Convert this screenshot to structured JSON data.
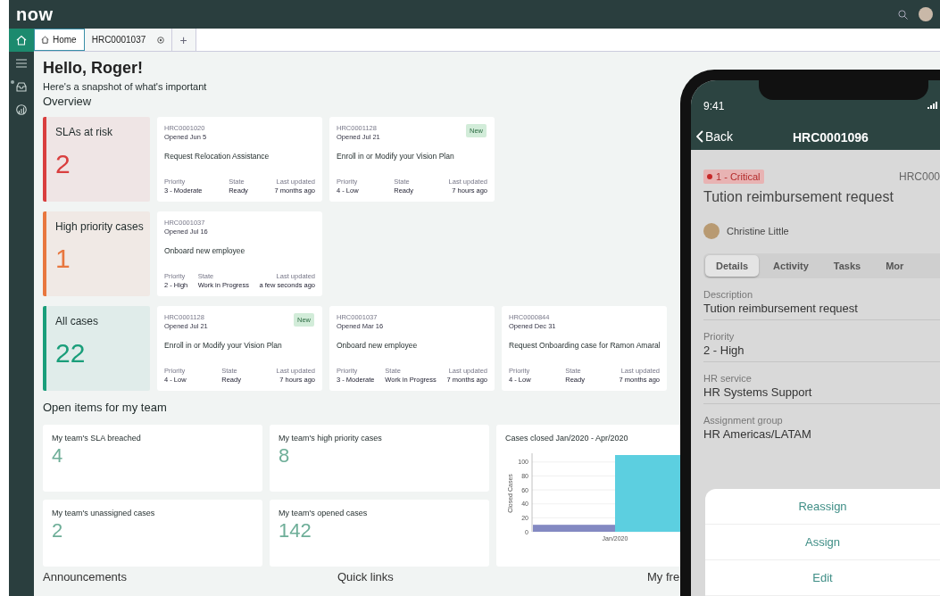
{
  "header": {
    "logo": "now"
  },
  "nav_items": [
    {
      "kind": "home",
      "selected": true,
      "notification": false
    },
    {
      "kind": "list",
      "selected": false,
      "notification": false
    },
    {
      "kind": "inbox",
      "selected": false,
      "notification": true
    },
    {
      "kind": "analytics",
      "selected": false,
      "notification": false
    }
  ],
  "tabs": [
    {
      "label": "Home",
      "kind": "home",
      "selected": true
    },
    {
      "label": "HRC0001037",
      "kind": "record",
      "selected": false
    }
  ],
  "new_tab": "+",
  "greeting": "Hello, Roger!",
  "subtitle": "Here's a snapshot of what's important",
  "overview_heading": "Overview",
  "overview_rows": [
    {
      "summary": {
        "label": "SLAs at risk",
        "count": "2",
        "color": "#d93f3f"
      },
      "cases": [
        {
          "number": "HRC0001020",
          "opened": "Opened Jun 5",
          "title": "Request Relocation Assistance",
          "fields": [
            {
              "label": "Priority",
              "value": "3 - Moderate"
            },
            {
              "label": "State",
              "value": "Ready"
            },
            {
              "label": "Last updated",
              "value": "7 months ago"
            }
          ]
        },
        {
          "number": "HRC0001128",
          "opened": "Opened Jul 21",
          "badge": "New",
          "title": "Enroll in or Modify your Vision Plan",
          "fields": [
            {
              "label": "Priority",
              "value": "4 - Low"
            },
            {
              "label": "State",
              "value": "Ready"
            },
            {
              "label": "Last updated",
              "value": "7 hours ago"
            }
          ]
        }
      ]
    },
    {
      "summary": {
        "label": "High priority cases",
        "count": "1",
        "color": "#e8773f"
      },
      "cases": [
        {
          "number": "HRC0001037",
          "opened": "Opened Jul 16",
          "title": "Onboard new employee",
          "fields": [
            {
              "label": "Priority",
              "value": "2 - High"
            },
            {
              "label": "State",
              "value": "Work in Progress"
            },
            {
              "label": "Last updated",
              "value": "a few seconds ago"
            }
          ]
        }
      ]
    },
    {
      "summary": {
        "label": "All cases",
        "count": "22",
        "color": "#1a9e7a"
      },
      "cases": [
        {
          "number": "HRC0001128",
          "opened": "Opened Jul 21",
          "badge": "New",
          "title": "Enroll in or Modify your Vision Plan",
          "fields": [
            {
              "label": "Priority",
              "value": "4 - Low"
            },
            {
              "label": "State",
              "value": "Ready"
            },
            {
              "label": "Last updated",
              "value": "7 hours ago"
            }
          ]
        },
        {
          "number": "HRC0001037",
          "opened": "Opened Mar 16",
          "title": "Onboard new employee",
          "fields": [
            {
              "label": "Priority",
              "value": "3 - Moderate"
            },
            {
              "label": "State",
              "value": "Work in Progress"
            },
            {
              "label": "Last updated",
              "value": "7 months ago"
            }
          ]
        },
        {
          "number": "HRC0000844",
          "opened": "Opened Dec 31",
          "title": "Request Onboarding case for Ramon Amaral",
          "fields": [
            {
              "label": "Priority",
              "value": "4 - Low"
            },
            {
              "label": "State",
              "value": "Ready"
            },
            {
              "label": "Last updated",
              "value": "7 months ago"
            }
          ]
        }
      ]
    }
  ],
  "team": {
    "heading": "Open items for my team",
    "metrics": [
      {
        "label": "My team's SLA breached",
        "value": "4"
      },
      {
        "label": "My team's high priority cases",
        "value": "8"
      },
      {
        "label": "My team's unassigned cases",
        "value": "2"
      },
      {
        "label": "My team's opened cases",
        "value": "142"
      }
    ],
    "chart": {
      "title": "Cases closed Jan/2020 - Apr/2020",
      "chart_data": {
        "type": "bar",
        "ylabel": "Closed Cases",
        "categories": [
          "Jan/2020"
        ],
        "series": [
          {
            "color": "#8389c2",
            "values": [
              10
            ]
          },
          {
            "color": "#5ccfe0",
            "values": [
              110
            ]
          }
        ],
        "yticks": [
          0,
          20,
          40,
          60,
          80,
          100
        ],
        "ylim": [
          0,
          110
        ],
        "grid": true
      }
    }
  },
  "bottom_sections": [
    "Announcements",
    "Quick links",
    "My fre"
  ],
  "phone": {
    "time": "9:41",
    "back": "Back",
    "title": "HRC0001096",
    "priority": "1 - Critical",
    "number": "HRC000",
    "case_title": "Tution reimbursement request",
    "assignee": "Christine Little",
    "tabs": [
      {
        "label": "Details",
        "selected": true
      },
      {
        "label": "Activity",
        "selected": false
      },
      {
        "label": "Tasks",
        "selected": false
      },
      {
        "label": "Mor",
        "selected": false
      }
    ],
    "fields": [
      {
        "label": "Description",
        "value": "Tution reimbursement request"
      },
      {
        "label": "Priority",
        "value": "2 - High"
      },
      {
        "label": "HR service",
        "value": "HR Systems Support"
      },
      {
        "label": "Assignment group",
        "value": "HR Americas/LATAM"
      }
    ],
    "actions": [
      "Reassign",
      "Assign",
      "Edit"
    ]
  }
}
